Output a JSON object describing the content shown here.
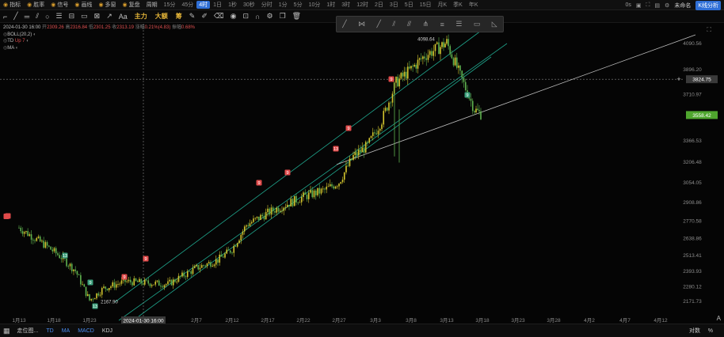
{
  "top_bar": {
    "items": [
      {
        "label": "指标",
        "icon": "indicator-icon"
      },
      {
        "label": "胜率",
        "icon": "trophy-icon"
      },
      {
        "label": "信号",
        "icon": "signal-icon"
      },
      {
        "label": "画线",
        "icon": "pen-icon"
      },
      {
        "label": "多窗",
        "icon": "windows-icon"
      },
      {
        "label": "复盘",
        "icon": "replay-icon"
      }
    ],
    "period_label": "周期",
    "timeframes": [
      "15分",
      "45分",
      "4时",
      "1日",
      "1秒",
      "30秒",
      "分时",
      "1分",
      "5分",
      "10分",
      "1时",
      "3时",
      "12时",
      "2日",
      "3日",
      "5日",
      "15日",
      "月K",
      "季K",
      "年K"
    ],
    "active_timeframe": "4时",
    "right": {
      "version": "0s",
      "user": "未命名",
      "kline_button": "K线分析"
    }
  },
  "tool_bar": {
    "text_tool": "Aa",
    "chips": [
      {
        "label": "主力",
        "color": "#e8b83a"
      },
      {
        "label": "大额",
        "color": "#e8b83a"
      },
      {
        "label": "筹",
        "color": "#e8b83a"
      }
    ]
  },
  "info": {
    "datetime": "2024-01-30 16:00",
    "open_label": "开",
    "open": "2309.26",
    "high_label": "高",
    "high": "2316.84",
    "low_label": "低",
    "low": "2301.25",
    "close_label": "收",
    "close": "2313.19",
    "change_label": "涨幅",
    "change": "0.21%(4.83)",
    "amp_label": "振幅",
    "amp": "0.68%",
    "boll": "BOLL(20,2)",
    "td_label": "TD",
    "td_value": "Up 7",
    "ma": "MA"
  },
  "chart_data": {
    "type": "candlestick",
    "title": "",
    "y_ticks": [
      "4090.56",
      "3896.20",
      "3710.97",
      "3366.53",
      "3206.48",
      "3054.05",
      "2908.86",
      "2770.58",
      "2638.86",
      "2513.41",
      "2393.93",
      "2280.12",
      "2171.73"
    ],
    "x_ticks": [
      "1月13",
      "1月18",
      "1月23",
      "2月7",
      "2月12",
      "2月17",
      "2月22",
      "2月27",
      "3月3",
      "3月8",
      "3月13",
      "3月18",
      "3月23",
      "3月28",
      "4月2",
      "4月7",
      "4月12"
    ],
    "crosshair": {
      "price": "3824.75",
      "date": "2024-01-30 16:00"
    },
    "current_price": "3558.42",
    "annotations": [
      {
        "label": "4098.64",
        "type": "high"
      },
      {
        "label": "2167.90",
        "type": "low"
      }
    ],
    "close_path": [
      [
        "1月13",
        2720
      ],
      [
        "1月15",
        2650
      ],
      [
        "1月17",
        2580
      ],
      [
        "1月19",
        2500
      ],
      [
        "1月21",
        2400
      ],
      [
        "1月23",
        2180
      ],
      [
        "1月25",
        2270
      ],
      [
        "1月28",
        2320
      ],
      [
        "1月30",
        2313
      ],
      [
        "2月3",
        2300
      ],
      [
        "2月7",
        2420
      ],
      [
        "2月10",
        2480
      ],
      [
        "2月12",
        2560
      ],
      [
        "2月14",
        2740
      ],
      [
        "2月17",
        2830
      ],
      [
        "2月19",
        2880
      ],
      [
        "2月22",
        2950
      ],
      [
        "2月25",
        3000
      ],
      [
        "2月27",
        3060
      ],
      [
        "2月29",
        3250
      ],
      [
        "3月2",
        3330
      ],
      [
        "3月4",
        3520
      ],
      [
        "3月6",
        3800
      ],
      [
        "3月8",
        3900
      ],
      [
        "3月10",
        4000
      ],
      [
        "3月12",
        4060
      ],
      [
        "3月13",
        4098
      ],
      [
        "3月15",
        3850
      ],
      [
        "3月17",
        3600
      ],
      [
        "3月18",
        3558
      ]
    ],
    "td_markers": [
      {
        "label": "9",
        "date": "1月13"
      },
      {
        "label": "13",
        "date": "1月19"
      },
      {
        "label": "9",
        "date": "1月23"
      },
      {
        "label": "13",
        "date": "1月24"
      },
      {
        "label": "9",
        "date": "1月31"
      },
      {
        "label": "9",
        "date": "2月3"
      },
      {
        "label": "9",
        "date": "2月14"
      },
      {
        "label": "9",
        "date": "2月21"
      },
      {
        "label": "13",
        "date": "2月27"
      },
      {
        "label": "9",
        "date": "2月29"
      },
      {
        "label": "9",
        "date": "3月4"
      },
      {
        "label": "9",
        "date": "3月18"
      }
    ],
    "grid": false
  },
  "draw_toolbar": {
    "tools": [
      "line-icon",
      "parallel-icon",
      "ray-icon",
      "channel-icon",
      "fib-icon",
      "pitchfork-icon",
      "hline-icon",
      "gann-icon",
      "rect-icon",
      "measure-icon"
    ]
  },
  "bottom_bar": {
    "layout_label": "走位图...",
    "indicators": [
      "TD",
      "MA",
      "MACD",
      "KDJ"
    ],
    "right_labels": [
      "对数",
      "%"
    ],
    "symbol_tick": "A"
  },
  "colors": {
    "up": "#e04a4a",
    "down": "#5fb24f",
    "wick_up": "#d4c62e",
    "channel": "#1fa58c",
    "trendline": "#bfbfbf",
    "price_tag": "#4fa62e",
    "active_tf": "#2f6fd6"
  }
}
